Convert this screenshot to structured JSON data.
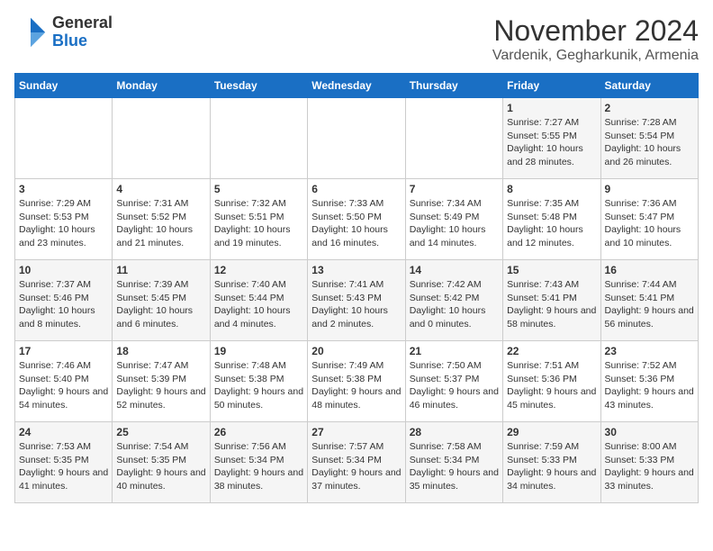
{
  "logo": {
    "general": "General",
    "blue": "Blue"
  },
  "header": {
    "month": "November 2024",
    "location": "Vardenik, Gegharkunik, Armenia"
  },
  "weekdays": [
    "Sunday",
    "Monday",
    "Tuesday",
    "Wednesday",
    "Thursday",
    "Friday",
    "Saturday"
  ],
  "weeks": [
    [
      {
        "day": "",
        "info": ""
      },
      {
        "day": "",
        "info": ""
      },
      {
        "day": "",
        "info": ""
      },
      {
        "day": "",
        "info": ""
      },
      {
        "day": "",
        "info": ""
      },
      {
        "day": "1",
        "info": "Sunrise: 7:27 AM\nSunset: 5:55 PM\nDaylight: 10 hours and 28 minutes."
      },
      {
        "day": "2",
        "info": "Sunrise: 7:28 AM\nSunset: 5:54 PM\nDaylight: 10 hours and 26 minutes."
      }
    ],
    [
      {
        "day": "3",
        "info": "Sunrise: 7:29 AM\nSunset: 5:53 PM\nDaylight: 10 hours and 23 minutes."
      },
      {
        "day": "4",
        "info": "Sunrise: 7:31 AM\nSunset: 5:52 PM\nDaylight: 10 hours and 21 minutes."
      },
      {
        "day": "5",
        "info": "Sunrise: 7:32 AM\nSunset: 5:51 PM\nDaylight: 10 hours and 19 minutes."
      },
      {
        "day": "6",
        "info": "Sunrise: 7:33 AM\nSunset: 5:50 PM\nDaylight: 10 hours and 16 minutes."
      },
      {
        "day": "7",
        "info": "Sunrise: 7:34 AM\nSunset: 5:49 PM\nDaylight: 10 hours and 14 minutes."
      },
      {
        "day": "8",
        "info": "Sunrise: 7:35 AM\nSunset: 5:48 PM\nDaylight: 10 hours and 12 minutes."
      },
      {
        "day": "9",
        "info": "Sunrise: 7:36 AM\nSunset: 5:47 PM\nDaylight: 10 hours and 10 minutes."
      }
    ],
    [
      {
        "day": "10",
        "info": "Sunrise: 7:37 AM\nSunset: 5:46 PM\nDaylight: 10 hours and 8 minutes."
      },
      {
        "day": "11",
        "info": "Sunrise: 7:39 AM\nSunset: 5:45 PM\nDaylight: 10 hours and 6 minutes."
      },
      {
        "day": "12",
        "info": "Sunrise: 7:40 AM\nSunset: 5:44 PM\nDaylight: 10 hours and 4 minutes."
      },
      {
        "day": "13",
        "info": "Sunrise: 7:41 AM\nSunset: 5:43 PM\nDaylight: 10 hours and 2 minutes."
      },
      {
        "day": "14",
        "info": "Sunrise: 7:42 AM\nSunset: 5:42 PM\nDaylight: 10 hours and 0 minutes."
      },
      {
        "day": "15",
        "info": "Sunrise: 7:43 AM\nSunset: 5:41 PM\nDaylight: 9 hours and 58 minutes."
      },
      {
        "day": "16",
        "info": "Sunrise: 7:44 AM\nSunset: 5:41 PM\nDaylight: 9 hours and 56 minutes."
      }
    ],
    [
      {
        "day": "17",
        "info": "Sunrise: 7:46 AM\nSunset: 5:40 PM\nDaylight: 9 hours and 54 minutes."
      },
      {
        "day": "18",
        "info": "Sunrise: 7:47 AM\nSunset: 5:39 PM\nDaylight: 9 hours and 52 minutes."
      },
      {
        "day": "19",
        "info": "Sunrise: 7:48 AM\nSunset: 5:38 PM\nDaylight: 9 hours and 50 minutes."
      },
      {
        "day": "20",
        "info": "Sunrise: 7:49 AM\nSunset: 5:38 PM\nDaylight: 9 hours and 48 minutes."
      },
      {
        "day": "21",
        "info": "Sunrise: 7:50 AM\nSunset: 5:37 PM\nDaylight: 9 hours and 46 minutes."
      },
      {
        "day": "22",
        "info": "Sunrise: 7:51 AM\nSunset: 5:36 PM\nDaylight: 9 hours and 45 minutes."
      },
      {
        "day": "23",
        "info": "Sunrise: 7:52 AM\nSunset: 5:36 PM\nDaylight: 9 hours and 43 minutes."
      }
    ],
    [
      {
        "day": "24",
        "info": "Sunrise: 7:53 AM\nSunset: 5:35 PM\nDaylight: 9 hours and 41 minutes."
      },
      {
        "day": "25",
        "info": "Sunrise: 7:54 AM\nSunset: 5:35 PM\nDaylight: 9 hours and 40 minutes."
      },
      {
        "day": "26",
        "info": "Sunrise: 7:56 AM\nSunset: 5:34 PM\nDaylight: 9 hours and 38 minutes."
      },
      {
        "day": "27",
        "info": "Sunrise: 7:57 AM\nSunset: 5:34 PM\nDaylight: 9 hours and 37 minutes."
      },
      {
        "day": "28",
        "info": "Sunrise: 7:58 AM\nSunset: 5:34 PM\nDaylight: 9 hours and 35 minutes."
      },
      {
        "day": "29",
        "info": "Sunrise: 7:59 AM\nSunset: 5:33 PM\nDaylight: 9 hours and 34 minutes."
      },
      {
        "day": "30",
        "info": "Sunrise: 8:00 AM\nSunset: 5:33 PM\nDaylight: 9 hours and 33 minutes."
      }
    ]
  ]
}
